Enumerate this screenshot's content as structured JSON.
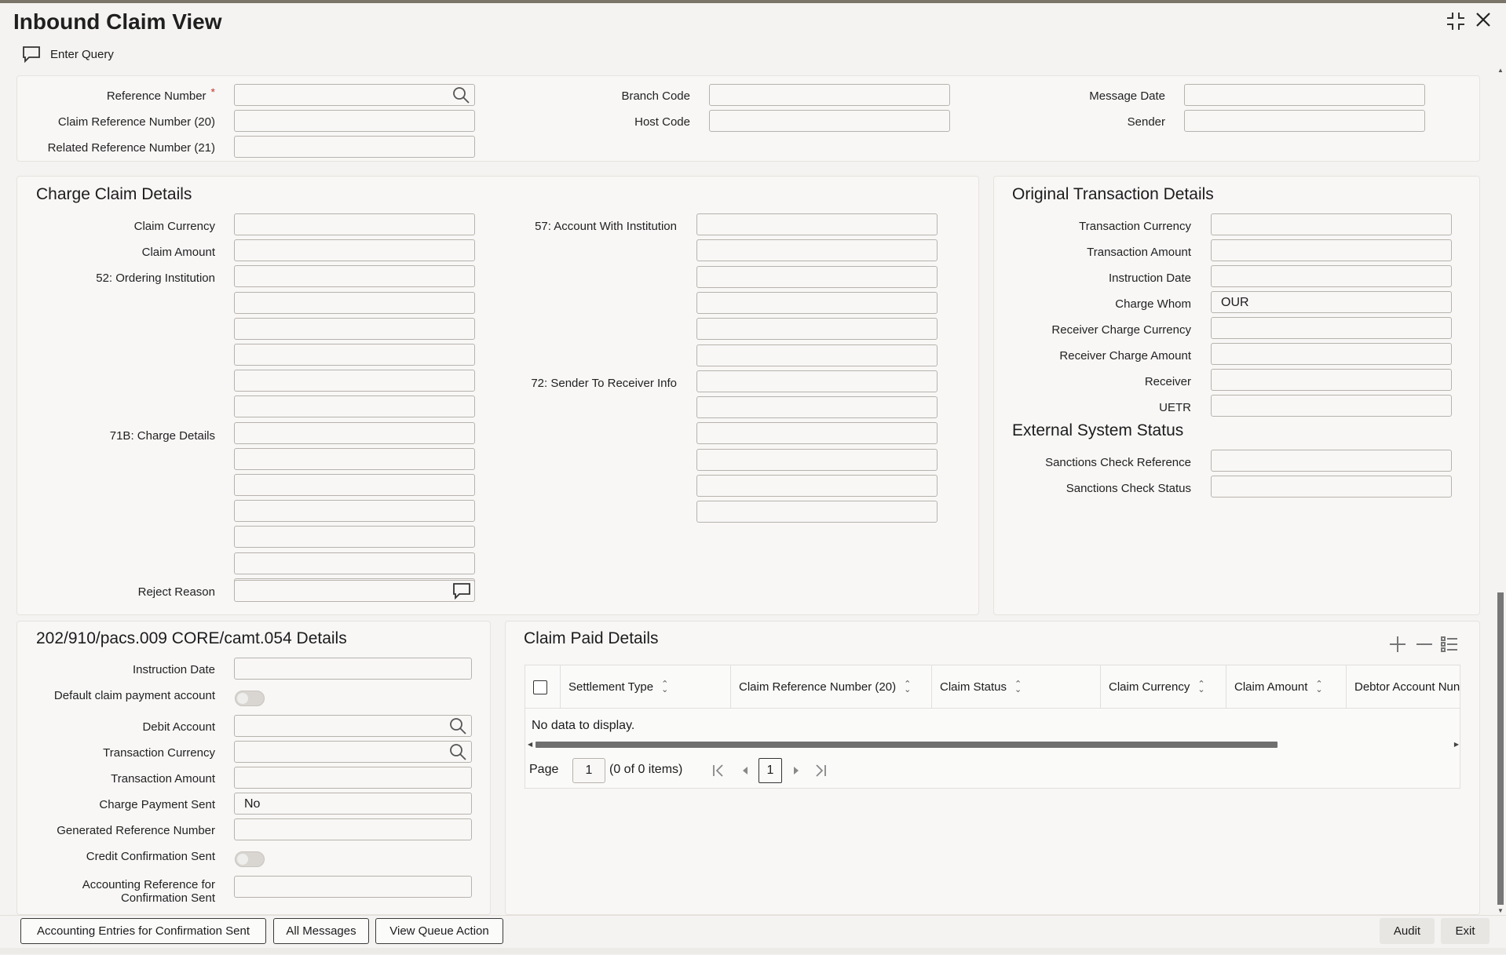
{
  "window": {
    "title": "Inbound Claim View"
  },
  "toolbar": {
    "enter_query": "Enter Query"
  },
  "header": {
    "reference_number": {
      "label": "Reference Number",
      "required_mark": "*",
      "value": ""
    },
    "claim_reference_number": {
      "label": "Claim Reference Number (20)",
      "value": ""
    },
    "related_reference_number": {
      "label": "Related Reference Number (21)",
      "value": ""
    },
    "branch_code": {
      "label": "Branch Code",
      "value": ""
    },
    "host_code": {
      "label": "Host Code",
      "value": ""
    },
    "message_date": {
      "label": "Message Date",
      "value": ""
    },
    "sender": {
      "label": "Sender",
      "value": ""
    }
  },
  "charge_claim": {
    "title": "Charge Claim Details",
    "claim_currency": "Claim Currency",
    "claim_amount": "Claim Amount",
    "ordering_institution": "52: Ordering Institution",
    "charge_details": "71B: Charge Details",
    "reject_reason": "Reject Reason",
    "account_with_institution": "57: Account With Institution",
    "sender_to_receiver_info": "72: Sender To Receiver Info"
  },
  "original_txn": {
    "title": "Original Transaction Details",
    "transaction_currency": {
      "label": "Transaction Currency",
      "value": ""
    },
    "transaction_amount": {
      "label": "Transaction Amount",
      "value": ""
    },
    "instruction_date": {
      "label": "Instruction Date",
      "value": ""
    },
    "charge_whom": {
      "label": "Charge Whom",
      "value": "OUR"
    },
    "receiver_charge_currency": {
      "label": "Receiver Charge Currency",
      "value": ""
    },
    "receiver_charge_amount": {
      "label": "Receiver Charge Amount",
      "value": ""
    },
    "receiver": {
      "label": "Receiver",
      "value": ""
    },
    "uetr": {
      "label": "UETR",
      "value": ""
    }
  },
  "external_status": {
    "title": "External System Status",
    "sanctions_check_reference": {
      "label": "Sanctions Check Reference",
      "value": ""
    },
    "sanctions_check_status": {
      "label": "Sanctions Check Status",
      "value": ""
    }
  },
  "pacs": {
    "title": "202/910/pacs.009 CORE/camt.054 Details",
    "instruction_date": "Instruction Date",
    "default_claim_payment_account": "Default claim payment account",
    "debit_account": "Debit Account",
    "transaction_currency": "Transaction Currency",
    "transaction_amount": "Transaction Amount",
    "charge_payment_sent": {
      "label": "Charge Payment Sent",
      "value": "No"
    },
    "generated_reference_number": "Generated Reference Number",
    "credit_confirmation_sent": "Credit Confirmation Sent",
    "accounting_reference_line1": "Accounting Reference for",
    "accounting_reference_line2": "Confirmation Sent"
  },
  "claim_paid": {
    "title": "Claim Paid Details",
    "columns": [
      "Settlement Type",
      "Claim Reference Number (20)",
      "Claim Status",
      "Claim Currency",
      "Claim Amount",
      "Debtor Account Nun"
    ],
    "empty_text": "No data to display.",
    "page_label": "Page",
    "page_value": "1",
    "items_text": "(0 of 0 items)",
    "current_page": "1"
  },
  "footer": {
    "accounting_entries": "Accounting Entries for Confirmation Sent",
    "all_messages": "All Messages",
    "view_queue_action": "View Queue Action",
    "audit": "Audit",
    "exit": "Exit"
  }
}
